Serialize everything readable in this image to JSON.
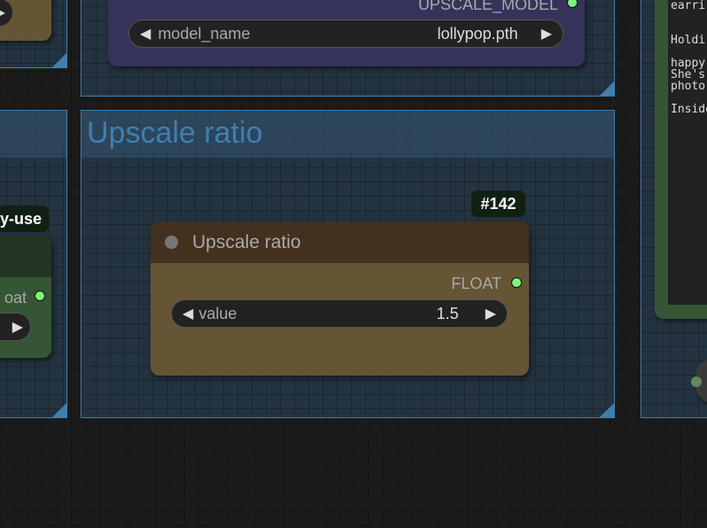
{
  "groups": {
    "upscale_ratio": {
      "title": "Upscale ratio"
    }
  },
  "upscale_model_node": {
    "output_label": "UPSCALE_MODEL",
    "widget": {
      "label": "model_name",
      "value": "lollypop.pth"
    }
  },
  "upscale_ratio_node": {
    "id_badge": "#142",
    "title": "Upscale ratio",
    "output_label": "FLOAT",
    "widget": {
      "label": "value",
      "value": "1.5"
    }
  },
  "left_node": {
    "badge": "y-use",
    "output_label": "oat"
  },
  "text_node": {
    "lines": [
      "earri",
      "",
      "",
      "Holdir",
      "",
      "happy",
      "She's",
      "photo",
      "",
      "Inside"
    ]
  },
  "colors": {
    "group_border": "#3f7fb0",
    "float_dot": "#7cf57c",
    "node_header": "#43301f",
    "node_body": "#665535",
    "model_node": "#35335a"
  }
}
